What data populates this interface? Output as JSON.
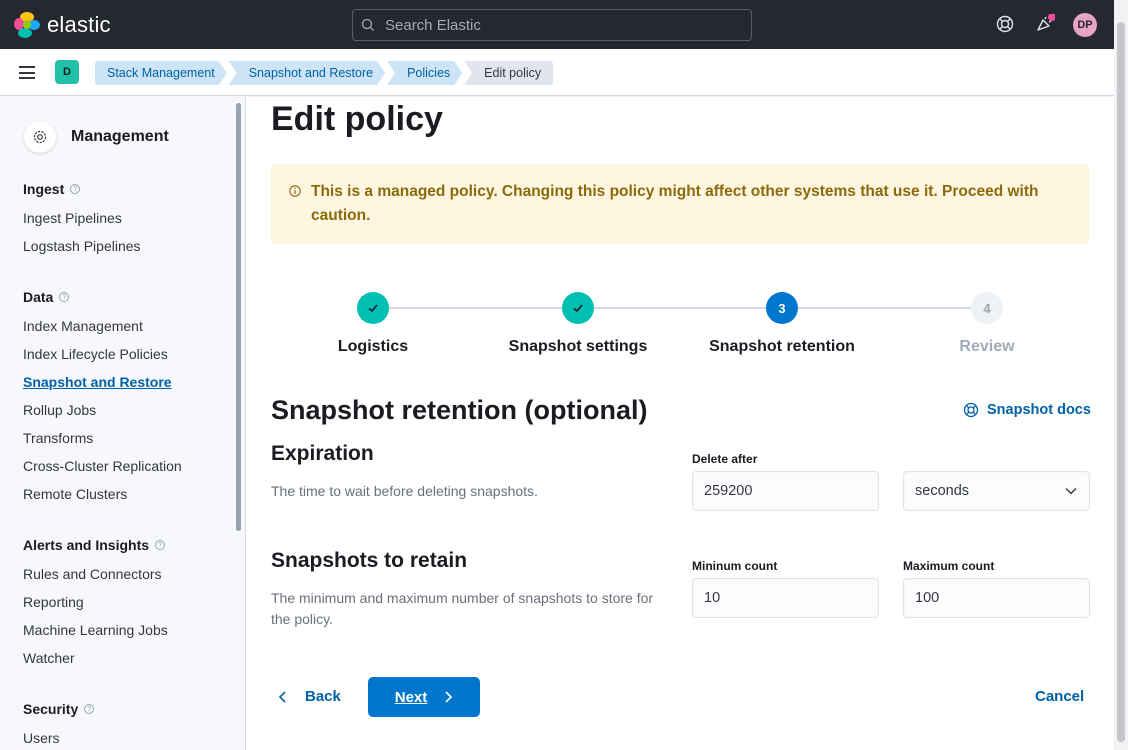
{
  "header": {
    "logo_text": "elastic",
    "search_placeholder": "Search Elastic",
    "avatar_initials": "DP",
    "icons": [
      "help-icon",
      "newsfeed-icon"
    ],
    "accent": "#e7a4c6"
  },
  "breadcrumb_bar": {
    "space_badge": "D",
    "crumbs": [
      "Stack Management",
      "Snapshot and Restore",
      "Policies",
      "Edit policy"
    ]
  },
  "sidebar": {
    "title": "Management",
    "groups": [
      {
        "heading": "Ingest",
        "items": [
          "Ingest Pipelines",
          "Logstash Pipelines"
        ]
      },
      {
        "heading": "Data",
        "items": [
          "Index Management",
          "Index Lifecycle Policies",
          "Snapshot and Restore",
          "Rollup Jobs",
          "Transforms",
          "Cross-Cluster Replication",
          "Remote Clusters"
        ]
      },
      {
        "heading": "Alerts and Insights",
        "items": [
          "Rules and Connectors",
          "Reporting",
          "Machine Learning Jobs",
          "Watcher"
        ]
      },
      {
        "heading": "Security",
        "items": [
          "Users"
        ]
      }
    ],
    "active_item": "Snapshot and Restore"
  },
  "main": {
    "page_title": "Edit policy",
    "callout": "This is a managed policy. Changing this policy might affect other systems that use it. Proceed with caution.",
    "steps": [
      {
        "label": "Logistics",
        "status": "complete"
      },
      {
        "label": "Snapshot settings",
        "status": "complete"
      },
      {
        "label": "Snapshot retention",
        "status": "current",
        "number": "3"
      },
      {
        "label": "Review",
        "status": "disabled",
        "number": "4"
      }
    ],
    "section_title": "Snapshot retention (optional)",
    "docs_link": "Snapshot docs",
    "expiration": {
      "title": "Expiration",
      "description": "The time to wait before deleting snapshots.",
      "delete_after_label": "Delete after",
      "delete_after_value": "259200",
      "unit_value": "seconds"
    },
    "retain": {
      "title": "Snapshots to retain",
      "description": "The minimum and maximum number of snapshots to store for the policy.",
      "min_label": "Mininum count",
      "min_value": "10",
      "max_label": "Maximum count",
      "max_value": "100"
    },
    "buttons": {
      "back": "Back",
      "next": "Next",
      "cancel": "Cancel"
    }
  }
}
